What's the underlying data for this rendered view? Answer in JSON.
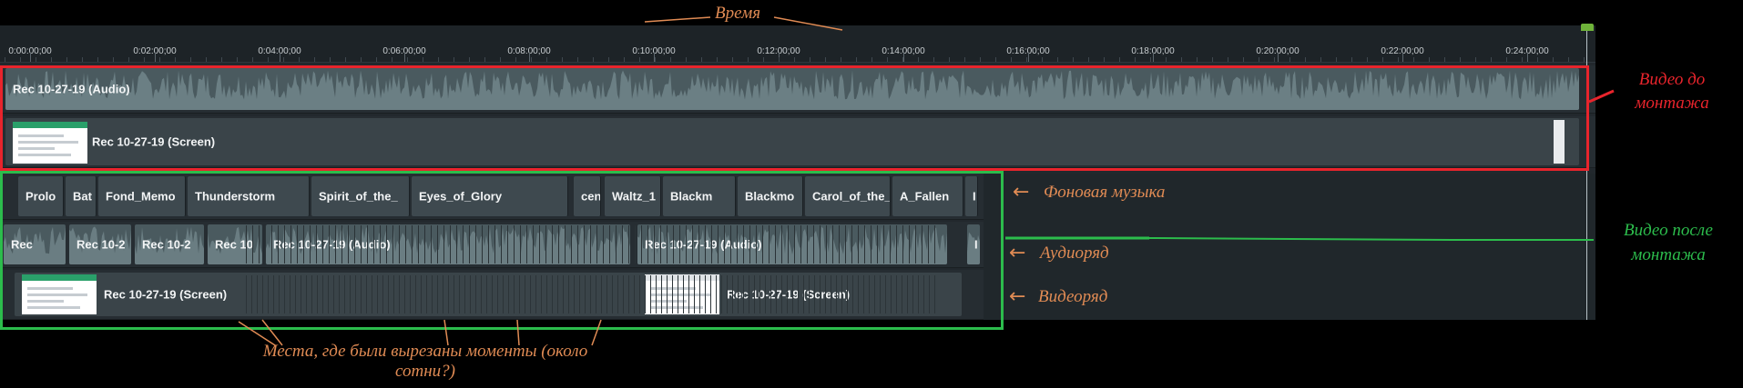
{
  "ruler": {
    "ticks": [
      "0:00:00;00",
      "0:02:00;00",
      "0:04:00;00",
      "0:06:00;00",
      "0:08:00;00",
      "0:10:00;00",
      "0:12:00;00",
      "0:14:00;00",
      "0:16:00;00",
      "0:18:00;00",
      "0:20:00;00",
      "0:22:00;00",
      "0:24:00;00"
    ]
  },
  "before_edit": {
    "audio_clip": "Rec 10-27-19 (Audio)",
    "screen_clip": "Rec 10-27-19 (Screen)"
  },
  "after_edit": {
    "music_clips": [
      "Prolo",
      "Bat",
      "Fond_Memo",
      "Thunderstorm",
      "Spirit_of_the_",
      "Eyes_of_Glory",
      "cen",
      "Waltz_1",
      "Blackm",
      "Blackmo",
      "Carol_of_the_",
      "A_Fallen",
      "I"
    ],
    "audio_clips": [
      "Rec",
      "Rec 10-2",
      "Rec 10-2",
      "Rec 10",
      "Rec 10-27-19 (Audio)",
      "Rec 10-27-19 (Audio)",
      "I"
    ],
    "video_clips": [
      "Rec 10-27-19 (Screen)",
      "Rec 10-27-19 (Screen)"
    ]
  },
  "annotations": {
    "time": "Время",
    "before": "Видео до монтажа",
    "after": "Видео после монтажа",
    "music": "Фоновая музыка",
    "audio_track": "Аудиоряд",
    "video_track": "Видеоряд",
    "cuts": "Места, где были вырезаны моменты (около сотни?)"
  },
  "colors": {
    "before_frame": "#e8242c",
    "after_frame": "#2cbc4c",
    "annotation": "#e08b54"
  }
}
